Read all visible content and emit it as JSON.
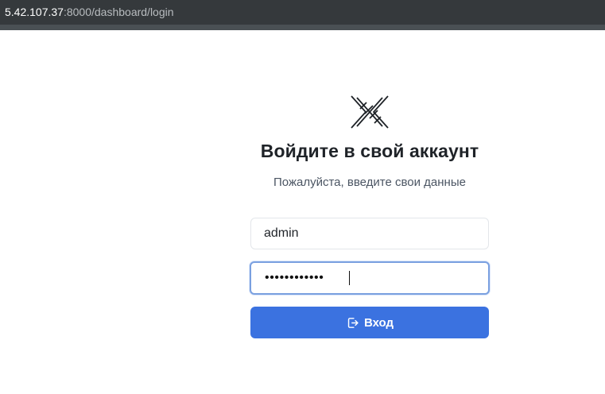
{
  "browser": {
    "url_host": "5.42.107.37",
    "url_rest": ":8000/dashboard/login"
  },
  "login": {
    "logo_icon": "crossed-barbed-wire-icon",
    "title": "Войдите в свой аккаунт",
    "subtitle": "Пожалуйста, введите свои данные",
    "username_value": "admin",
    "password_masked": "••••••••••••",
    "submit_label": "Вход",
    "submit_icon": "sign-in-icon",
    "accent_color": "#3b72e0"
  }
}
